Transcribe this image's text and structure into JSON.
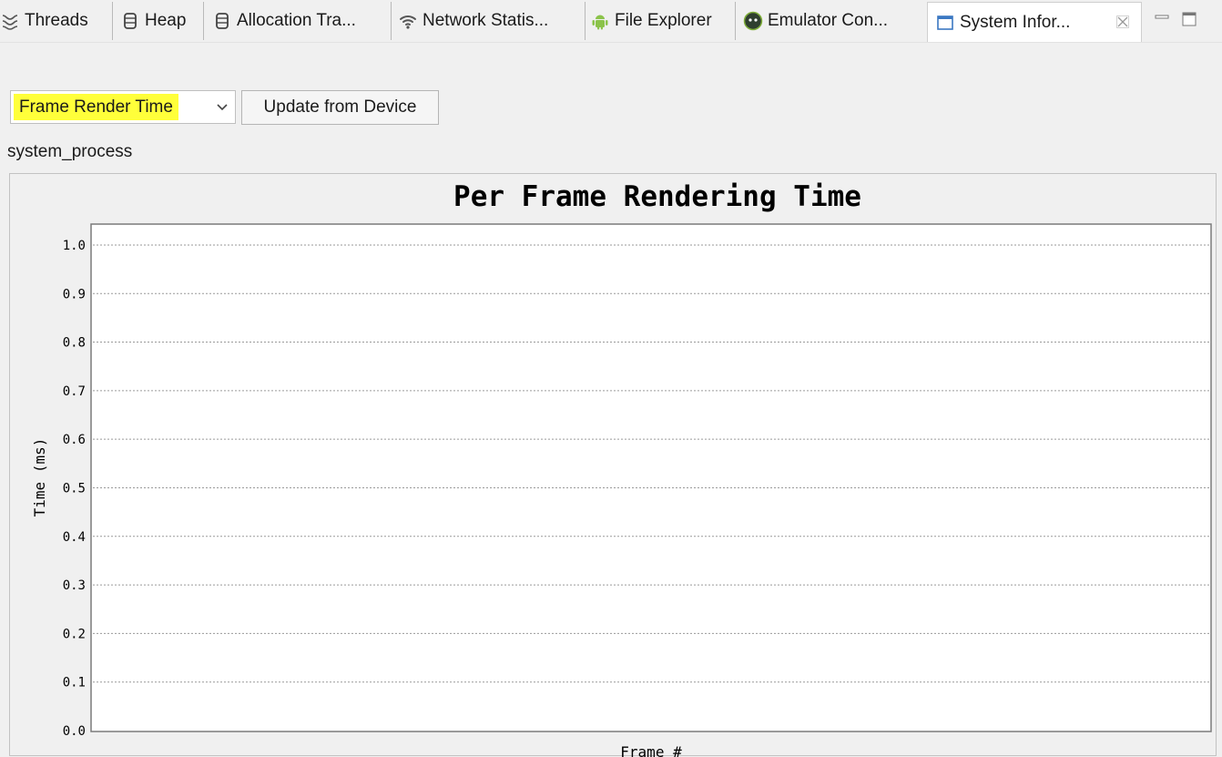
{
  "tabs": [
    {
      "label": "Threads",
      "icon": "threads-icon"
    },
    {
      "label": "Heap",
      "icon": "heap-icon"
    },
    {
      "label": "Allocation Tra...",
      "icon": "allocation-tracker-icon"
    },
    {
      "label": "Network Statis...",
      "icon": "wifi-icon"
    },
    {
      "label": "File Explorer",
      "icon": "android-icon"
    },
    {
      "label": "Emulator Con...",
      "icon": "emulator-icon"
    },
    {
      "label": "System Infor...",
      "icon": "window-icon",
      "active": true
    }
  ],
  "window_controls": [
    "minimize-icon",
    "maximize-icon"
  ],
  "mode_select": {
    "value": "Frame Render Time",
    "highlight_color": "#ffff3a"
  },
  "update_button": {
    "label": "Update from Device"
  },
  "process_label": "system_process",
  "chart_data": {
    "type": "line",
    "title": "Per Frame Rendering Time",
    "xlabel": "Frame #",
    "ylabel": "Time (ms)",
    "ylim": [
      0.0,
      1.0
    ],
    "yticks": [
      "0.0",
      "0.1",
      "0.2",
      "0.3",
      "0.4",
      "0.5",
      "0.6",
      "0.7",
      "0.8",
      "0.9",
      "1.0"
    ],
    "series": [],
    "grid": true
  }
}
